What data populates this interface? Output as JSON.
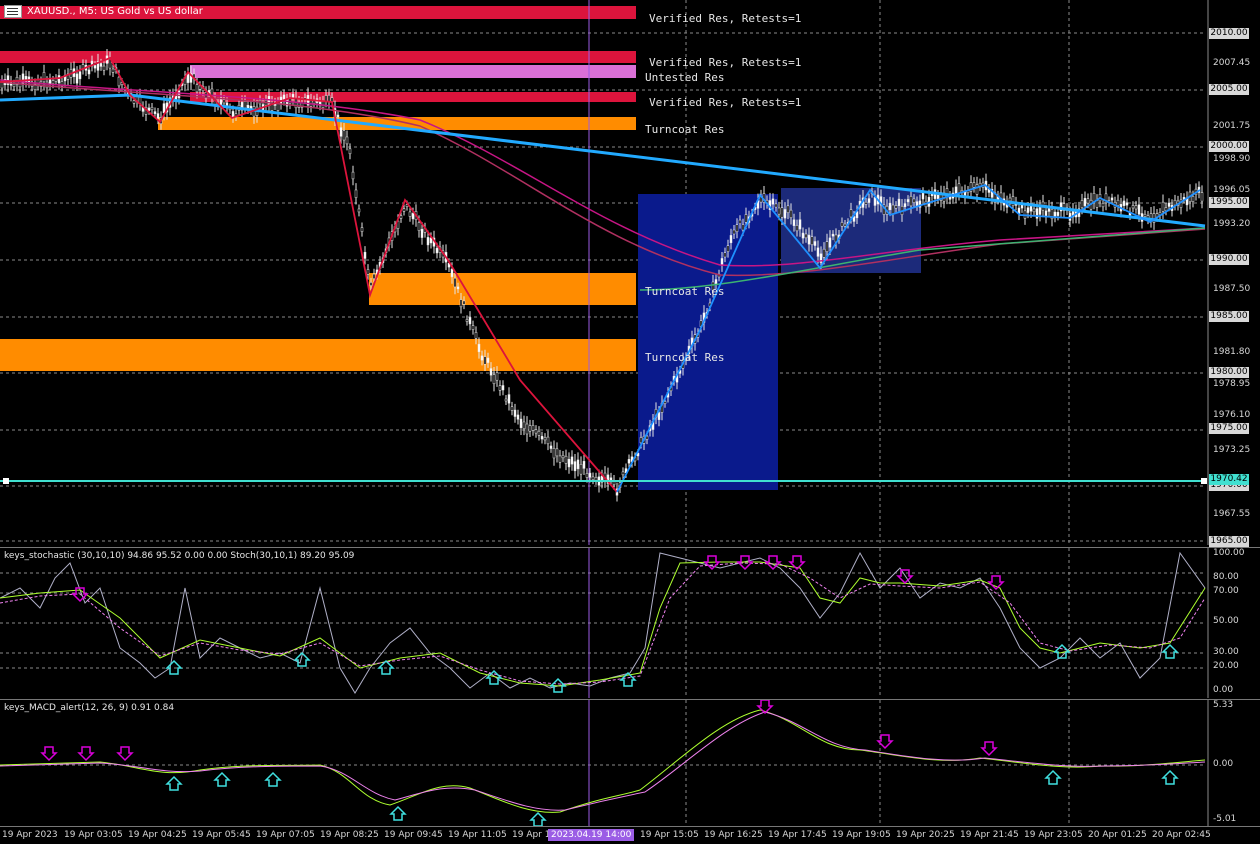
{
  "symbol": {
    "title": "XAUUSD., M5: US Gold vs US dollar",
    "icon": "chart-table-icon"
  },
  "zones": [
    {
      "label": "Verified Res, Retests=1",
      "color": "#dc143c"
    },
    {
      "label": "Verified Res, Retests=1",
      "color": "#dc143c"
    },
    {
      "label": "Untested Res",
      "color": "#da70d6"
    },
    {
      "label": "Verified Res, Retests=1",
      "color": "#dc143c"
    },
    {
      "label": "Turncoat Res",
      "color": "#ff8c00"
    },
    {
      "label": "Turncoat Res",
      "color": "#ff8c00"
    },
    {
      "label": "Turncoat Res",
      "color": "#ff8c00"
    }
  ],
  "price_axis": {
    "boxed": [
      "2010.00",
      "2005.00",
      "2000.00",
      "1995.00",
      "1990.00",
      "1985.00",
      "1980.00",
      "1975.00",
      "1970.00",
      "1965.00"
    ],
    "plain": [
      "2007.45",
      "2001.75",
      "1998.90",
      "1996.05",
      "1993.20",
      "1987.50",
      "1981.80",
      "1978.95",
      "1976.10",
      "1973.25",
      "1967.55"
    ],
    "current": "1970.42"
  },
  "stochastic": {
    "title": "keys_stochastic (30,10,10) 94.86 95.52 0.00 0.00 Stoch(30,10,1) 89.20 95.09",
    "levels": [
      "100.00",
      "80.00",
      "70.00",
      "50.00",
      "30.00",
      "20.00",
      "0.00"
    ]
  },
  "macd": {
    "title": "keys_MACD_alert(12, 26, 9) 0.91 0.84",
    "levels": [
      "5.33",
      "0.00",
      "-5.01"
    ]
  },
  "time_axis": {
    "labels": [
      "19 Apr 2023",
      "19 Apr 03:05",
      "19 Apr 04:25",
      "19 Apr 05:45",
      "19 Apr 07:05",
      "19 Apr 08:25",
      "19 Apr 09:45",
      "19 Apr 11:05",
      "19 Apr 1",
      "19 Apr 15:05",
      "19 Apr 16:25",
      "19 Apr 17:45",
      "19 Apr 19:05",
      "19 Apr 20:25",
      "19 Apr 21:45",
      "19 Apr 23:05",
      "20 Apr 01:25",
      "20 Apr 02:45"
    ],
    "cursor": "2023.04.19 14:00"
  },
  "colors": {
    "resistance": "#dc143c",
    "untested": "#da70d6",
    "turncoat": "#ff8c00",
    "box": "#0a1a8c",
    "zigzag_up": "#1e90ff",
    "zigzag_down": "#dc143c",
    "level_line": "#40e0d0"
  }
}
